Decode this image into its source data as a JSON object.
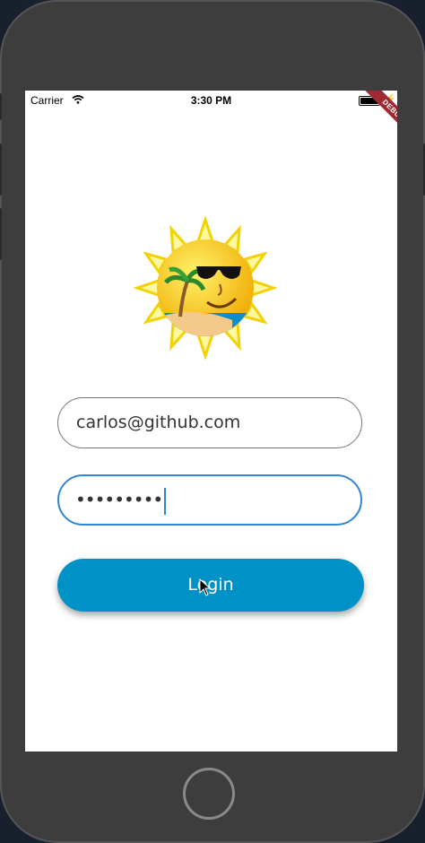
{
  "status_bar": {
    "carrier": "Carrier",
    "time": "3:30 PM"
  },
  "debug_banner": "DEBUG",
  "logo": {
    "icon": "sun-with-sunglasses-and-palm-tree-logo"
  },
  "login_form": {
    "email_value": "carlos@github.com",
    "password_value": "•••••••••",
    "login_label": "Login"
  },
  "colors": {
    "accent": "#0092c6",
    "focus_border": "#2f86d6"
  }
}
